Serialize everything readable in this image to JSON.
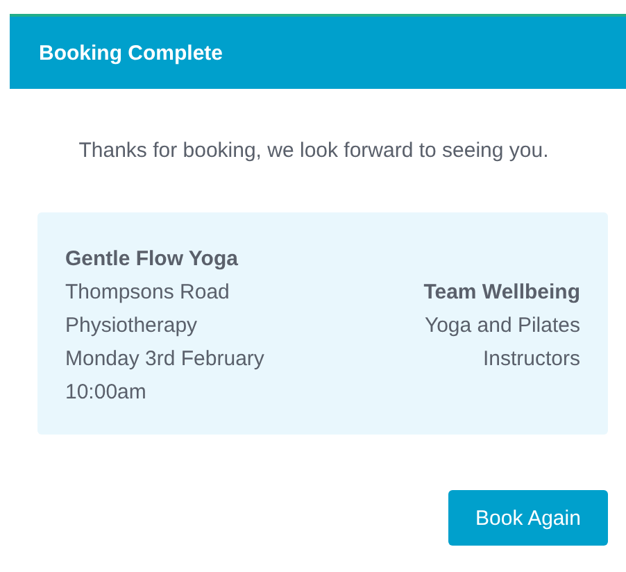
{
  "header": {
    "title": "Booking Complete"
  },
  "message": "Thanks for booking, we look forward to seeing you.",
  "booking": {
    "class_name": "Gentle Flow Yoga",
    "details": [
      "Thompsons Road",
      "Physiotherapy",
      "Monday 3rd February",
      "10:00am"
    ],
    "provider_name": "Team Wellbeing",
    "provider_details": [
      "Yoga and Pilates",
      "Instructors"
    ]
  },
  "buttons": [
    {
      "label": "Book Again"
    }
  ]
}
